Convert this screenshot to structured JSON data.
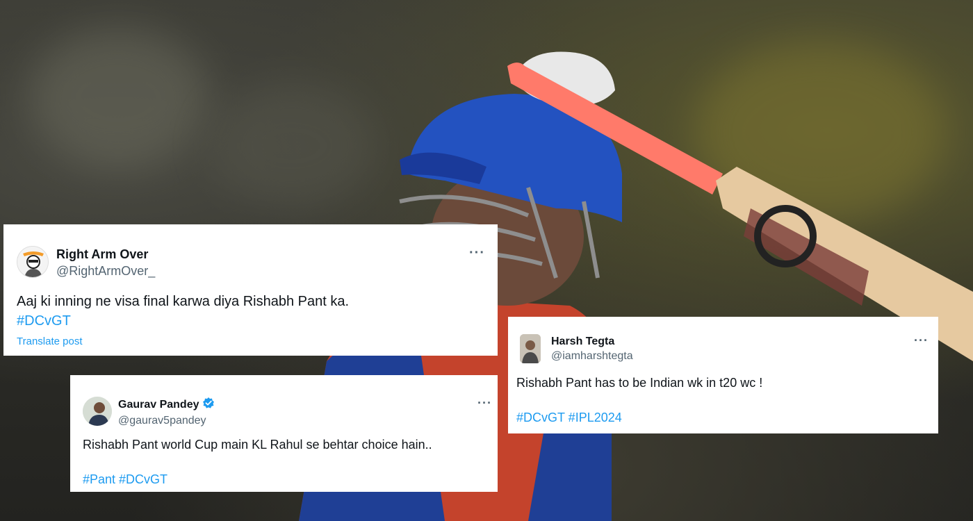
{
  "icons": {
    "more": "more-horizontal-icon",
    "verified": "verified-badge-icon"
  },
  "colors": {
    "link": "#1d9bf0",
    "handle": "#536471",
    "text": "#0f1419",
    "verified": "#1d9bf0"
  },
  "tweets": [
    {
      "name": "Right Arm Over",
      "handle": "@RightArmOver_",
      "text": "Aaj ki inning ne visa final karwa diya Rishabh Pant ka.",
      "hashtags": "#DCvGT",
      "translate": "Translate post",
      "more": "···"
    },
    {
      "name": "Harsh Tegta",
      "handle": "@iamharshtegta",
      "text": "Rishabh Pant has to be Indian wk in t20 wc !",
      "hashtags": "#DCvGT #IPL2024",
      "more": "···"
    },
    {
      "name": "Gaurav Pandey",
      "handle": "@gaurav5pandey",
      "verified": true,
      "text": "Rishabh Pant world Cup main KL Rahul se behtar choice hain..",
      "hashtags": "#Pant #DCvGT",
      "more": "···"
    }
  ]
}
